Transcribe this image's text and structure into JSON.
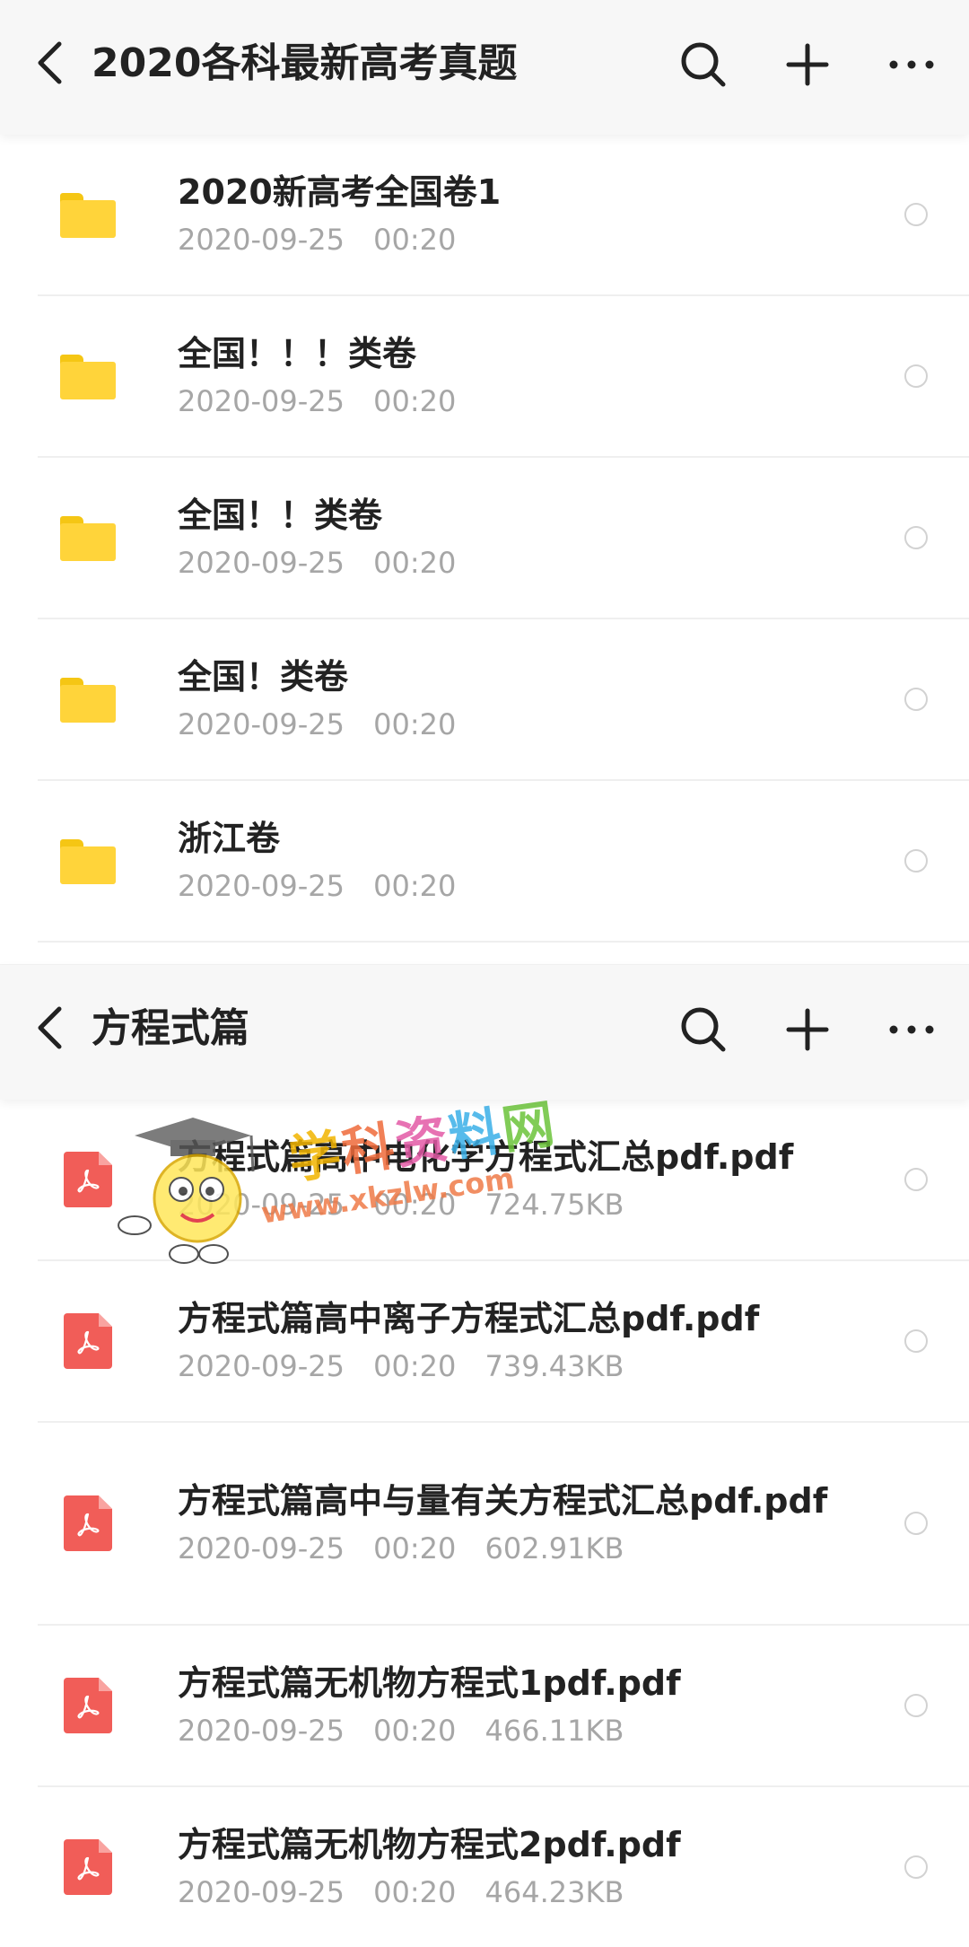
{
  "panels": [
    {
      "title": "2020各科最新高考真题",
      "items": [
        {
          "name": "2020新高考全国卷1",
          "date": "2020-09-25",
          "time": "00:20",
          "size": ""
        },
        {
          "name": "全国！！！类卷",
          "date": "2020-09-25",
          "time": "00:20",
          "size": ""
        },
        {
          "name": "全国！！类卷",
          "date": "2020-09-25",
          "time": "00:20",
          "size": ""
        },
        {
          "name": "全国！类卷",
          "date": "2020-09-25",
          "time": "00:20",
          "size": ""
        },
        {
          "name": "浙江卷",
          "date": "2020-09-25",
          "time": "00:20",
          "size": ""
        }
      ]
    },
    {
      "title": "方程式篇",
      "items": [
        {
          "name": "方程式篇高中电化学方程式汇总pdf.pdf",
          "date": "2020-09-25",
          "time": "00:20",
          "size": "724.75KB"
        },
        {
          "name": "方程式篇高中离子方程式汇总pdf.pdf",
          "date": "2020-09-25",
          "time": "00:20",
          "size": "739.43KB"
        },
        {
          "name": "方程式篇高中与量有关方程式汇总pdf.pdf",
          "date": "2020-09-25",
          "time": "00:20",
          "size": "602.91KB"
        },
        {
          "name": "方程式篇无机物方程式1pdf.pdf",
          "date": "2020-09-25",
          "time": "00:20",
          "size": "466.11KB"
        },
        {
          "name": "方程式篇无机物方程式2pdf.pdf",
          "date": "2020-09-25",
          "time": "00:20",
          "size": "464.23KB"
        }
      ]
    }
  ],
  "icons": {
    "back": "chevron-left-icon",
    "search": "search-icon",
    "add": "plus-icon",
    "more": "more-horizontal-icon",
    "folder": "folder-icon",
    "pdf": "pdf-file-icon"
  },
  "colors": {
    "folder": "#ffd43a",
    "pdf": "#f15d58",
    "meta_text": "#a6a6a6",
    "title_text": "#222222"
  },
  "watermark": {
    "text": "学科资料网",
    "url": "www.xkzlw.com"
  }
}
